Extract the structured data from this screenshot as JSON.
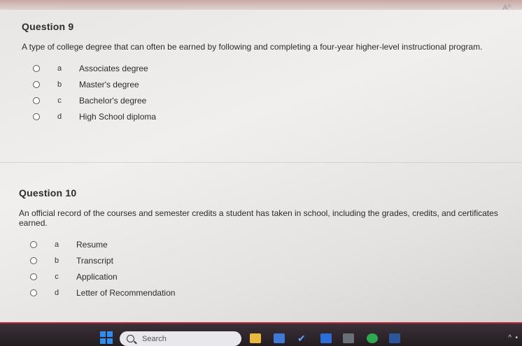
{
  "questions": [
    {
      "title": "Question 9",
      "text": "A type of college degree that can often be earned by following and completing a four-year higher-level instructional program.",
      "options": [
        {
          "letter": "a",
          "label": "Associates degree"
        },
        {
          "letter": "b",
          "label": "Master's degree"
        },
        {
          "letter": "c",
          "label": "Bachelor's degree"
        },
        {
          "letter": "d",
          "label": "High School diploma"
        }
      ]
    },
    {
      "title": "Question 10",
      "text": "An official record of the courses and semester credits a student has taken in school, including the grades, credits, and certificates earned.",
      "options": [
        {
          "letter": "a",
          "label": "Resume"
        },
        {
          "letter": "b",
          "label": "Transcript"
        },
        {
          "letter": "c",
          "label": "Application"
        },
        {
          "letter": "d",
          "label": "Letter of Recommendation"
        }
      ]
    }
  ],
  "taskbar": {
    "search_label": "Search",
    "icons": [
      "start-icon",
      "search-icon",
      "file-explorer-icon",
      "photos-icon",
      "check-app-icon",
      "store-icon",
      "calculator-icon",
      "chrome-icon",
      "word-icon"
    ],
    "accent_color": "#b62633"
  }
}
